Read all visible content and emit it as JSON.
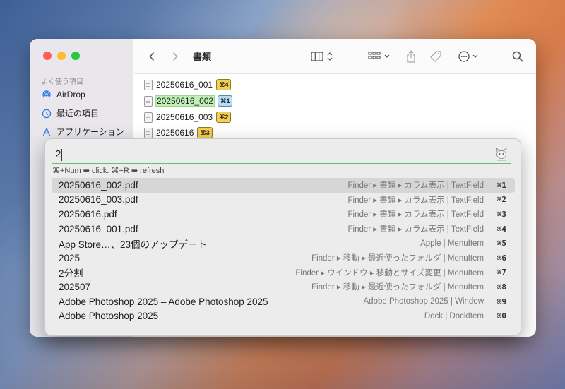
{
  "finder": {
    "sidebar": {
      "section_label": "よく使う項目",
      "items": [
        {
          "label": "AirDrop",
          "icon": "airdrop-icon"
        },
        {
          "label": "最近の項目",
          "icon": "clock-icon"
        },
        {
          "label": "アプリケーション",
          "icon": "applications-icon"
        }
      ]
    },
    "toolbar": {
      "title": "書類"
    },
    "files": [
      {
        "name": "20250616_001",
        "hint": "⌘4"
      },
      {
        "name": "20250616_002",
        "hint": "⌘1"
      },
      {
        "name": "20250616_003",
        "hint": "⌘2"
      },
      {
        "name": "20250616",
        "hint": "⌘3"
      }
    ]
  },
  "palette": {
    "query": "2",
    "hint": "⌘+Num ➡ click. ⌘+R ➡ refresh",
    "results": [
      {
        "title": "20250616_002.pdf",
        "meta": "Finder ▸ 書類 ▸ カラム表示 | TextField",
        "key": "⌘1"
      },
      {
        "title": "20250616_003.pdf",
        "meta": "Finder ▸ 書類 ▸ カラム表示 | TextField",
        "key": "⌘2"
      },
      {
        "title": "20250616.pdf",
        "meta": "Finder ▸ 書類 ▸ カラム表示 | TextField",
        "key": "⌘3"
      },
      {
        "title": "20250616_001.pdf",
        "meta": "Finder ▸ 書類 ▸ カラム表示 | TextField",
        "key": "⌘4"
      },
      {
        "title": "App Store…、23個のアップデート",
        "meta": "Apple | MenuItem",
        "key": "⌘5"
      },
      {
        "title": "2025",
        "meta": "Finder ▸ 移動 ▸ 最近使ったフォルダ | MenuItem",
        "key": "⌘6"
      },
      {
        "title": "2分割",
        "meta": "Finder ▸ ウインドウ ▸ 移動とサイズ変更 | MenuItem",
        "key": "⌘7"
      },
      {
        "title": "202507",
        "meta": "Finder ▸ 移動 ▸ 最近使ったフォルダ | MenuItem",
        "key": "⌘8"
      },
      {
        "title": "Adobe Photoshop 2025 – Adobe Photoshop 2025",
        "meta": "Adobe Photoshop 2025 | Window",
        "key": "⌘9"
      },
      {
        "title": "Adobe Photoshop 2025",
        "meta": "Dock | DockItem",
        "key": "⌘0"
      }
    ]
  },
  "colors": {
    "accent_green": "#62c463",
    "hint_yellow": "#f3cf53",
    "hint_blue": "#b8dcf3",
    "selected_row": "#d6d6d6"
  }
}
